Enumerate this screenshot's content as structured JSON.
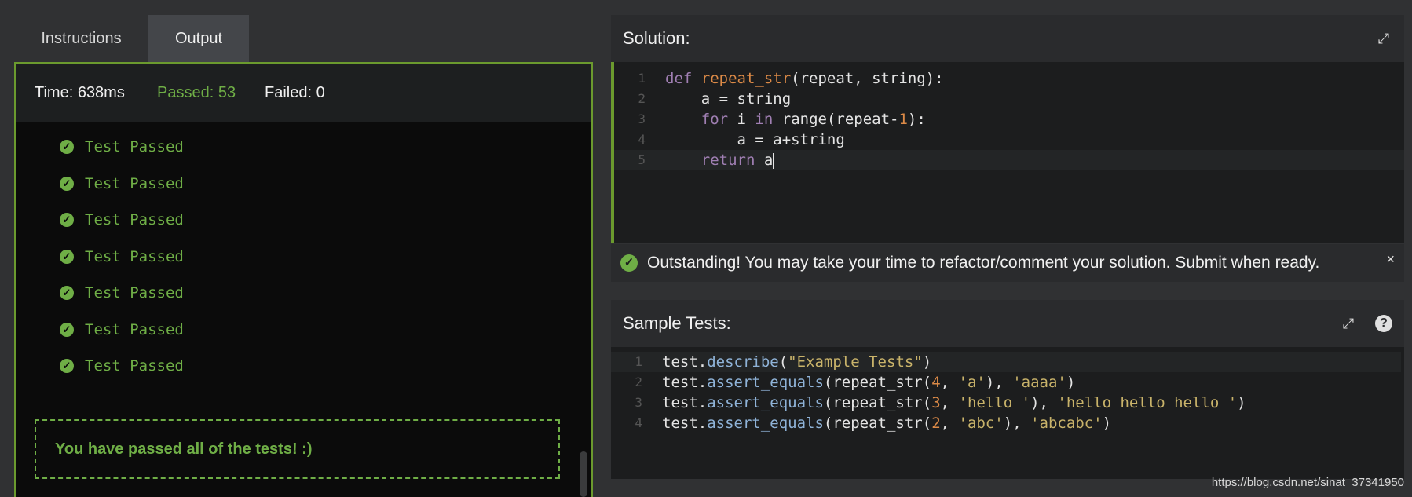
{
  "tabs": {
    "instructions": "Instructions",
    "output": "Output"
  },
  "stats": {
    "time": "Time: 638ms",
    "passed": "Passed: 53",
    "failed": "Failed: 0"
  },
  "results": [
    "Test Passed",
    "Test Passed",
    "Test Passed",
    "Test Passed",
    "Test Passed",
    "Test Passed",
    "Test Passed"
  ],
  "pass_all": "You have passed all of the tests! :)",
  "solution": {
    "title": "Solution:",
    "lines": [
      {
        "n": "1",
        "tokens": [
          [
            "kw",
            "def "
          ],
          [
            "fn",
            "repeat_str"
          ],
          [
            "",
            "(repeat, string):"
          ]
        ]
      },
      {
        "n": "2",
        "tokens": [
          [
            "",
            "    a = string"
          ]
        ]
      },
      {
        "n": "3",
        "tokens": [
          [
            "",
            "    "
          ],
          [
            "kw",
            "for"
          ],
          [
            "",
            " i "
          ],
          [
            "kw",
            "in"
          ],
          [
            "",
            " range(repeat-"
          ],
          [
            "num",
            "1"
          ],
          [
            "",
            "):"
          ]
        ]
      },
      {
        "n": "4",
        "tokens": [
          [
            "",
            "        a = a+string"
          ]
        ]
      },
      {
        "n": "5",
        "tokens": [
          [
            "",
            "    "
          ],
          [
            "kw",
            "return"
          ],
          [
            "",
            " a"
          ]
        ]
      }
    ]
  },
  "notice": {
    "message": "Outstanding! You may take your time to refactor/comment your solution. Submit when ready.",
    "close": "×"
  },
  "sample_tests": {
    "title": "Sample Tests:",
    "help": "?",
    "lines": [
      {
        "n": "1",
        "tokens": [
          [
            "",
            "test."
          ],
          [
            "attr",
            "describe"
          ],
          [
            "",
            "("
          ],
          [
            "str",
            "\"Example Tests\""
          ],
          [
            "",
            ")"
          ]
        ]
      },
      {
        "n": "2",
        "tokens": [
          [
            "",
            "test."
          ],
          [
            "attr",
            "assert_equals"
          ],
          [
            "",
            "(repeat_str("
          ],
          [
            "num",
            "4"
          ],
          [
            "",
            ", "
          ],
          [
            "str",
            "'a'"
          ],
          [
            "",
            "), "
          ],
          [
            "str",
            "'aaaa'"
          ],
          [
            "",
            ")"
          ]
        ]
      },
      {
        "n": "3",
        "tokens": [
          [
            "",
            "test."
          ],
          [
            "attr",
            "assert_equals"
          ],
          [
            "",
            "(repeat_str("
          ],
          [
            "num",
            "3"
          ],
          [
            "",
            ", "
          ],
          [
            "str",
            "'hello '"
          ],
          [
            "",
            "), "
          ],
          [
            "str",
            "'hello hello hello '"
          ],
          [
            "",
            ")"
          ]
        ]
      },
      {
        "n": "4",
        "tokens": [
          [
            "",
            "test."
          ],
          [
            "attr",
            "assert_equals"
          ],
          [
            "",
            "(repeat_str("
          ],
          [
            "num",
            "2"
          ],
          [
            "",
            ", "
          ],
          [
            "str",
            "'abc'"
          ],
          [
            "",
            "), "
          ],
          [
            "str",
            "'abcabc'"
          ],
          [
            "",
            ")"
          ]
        ]
      }
    ]
  },
  "icons": {
    "check": "check-circle-icon",
    "expand": "expand-icon",
    "help": "help-icon",
    "close": "close-icon"
  },
  "colors": {
    "accent_green": "#6fae46",
    "panel_border": "#6b9a2e",
    "background": "#303133"
  },
  "watermark": "https://blog.csdn.net/sinat_37341950"
}
